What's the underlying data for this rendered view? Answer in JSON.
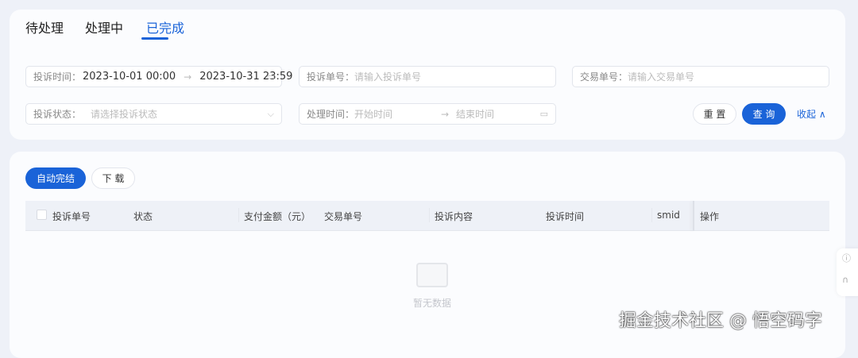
{
  "tabs": [
    "待处理",
    "处理中",
    "已完成"
  ],
  "filters": {
    "complaint_time": {
      "label": "投诉时间：",
      "start": "2023-10-01 00:00",
      "end": "2023-10-31 23:59"
    },
    "complaint_no": {
      "label": "投诉单号：",
      "placeholder": "请输入投诉单号"
    },
    "trade_no": {
      "label": "交易单号：",
      "placeholder": "请输入交易单号"
    },
    "status": {
      "label": "投诉状态：",
      "placeholder": "请选择投诉状态"
    },
    "handle_time": {
      "label": "处理时间：",
      "start_placeholder": "开始时间",
      "end_placeholder": "结束时间"
    },
    "arrow": "→"
  },
  "actions": {
    "reset": "重 置",
    "query": "查 询",
    "collapse": "收起"
  },
  "toolbar": {
    "auto_complete": "自动完结",
    "download": "下 载"
  },
  "table": {
    "columns": [
      "投诉单号",
      "状态",
      "支付金额（元）",
      "交易单号",
      "投诉内容",
      "投诉时间",
      "smid",
      "操作"
    ],
    "empty": "暂无数据"
  },
  "watermark": "掘金技术社区 @ 悟空码字",
  "colors": {
    "accent": "#1a63d8"
  }
}
